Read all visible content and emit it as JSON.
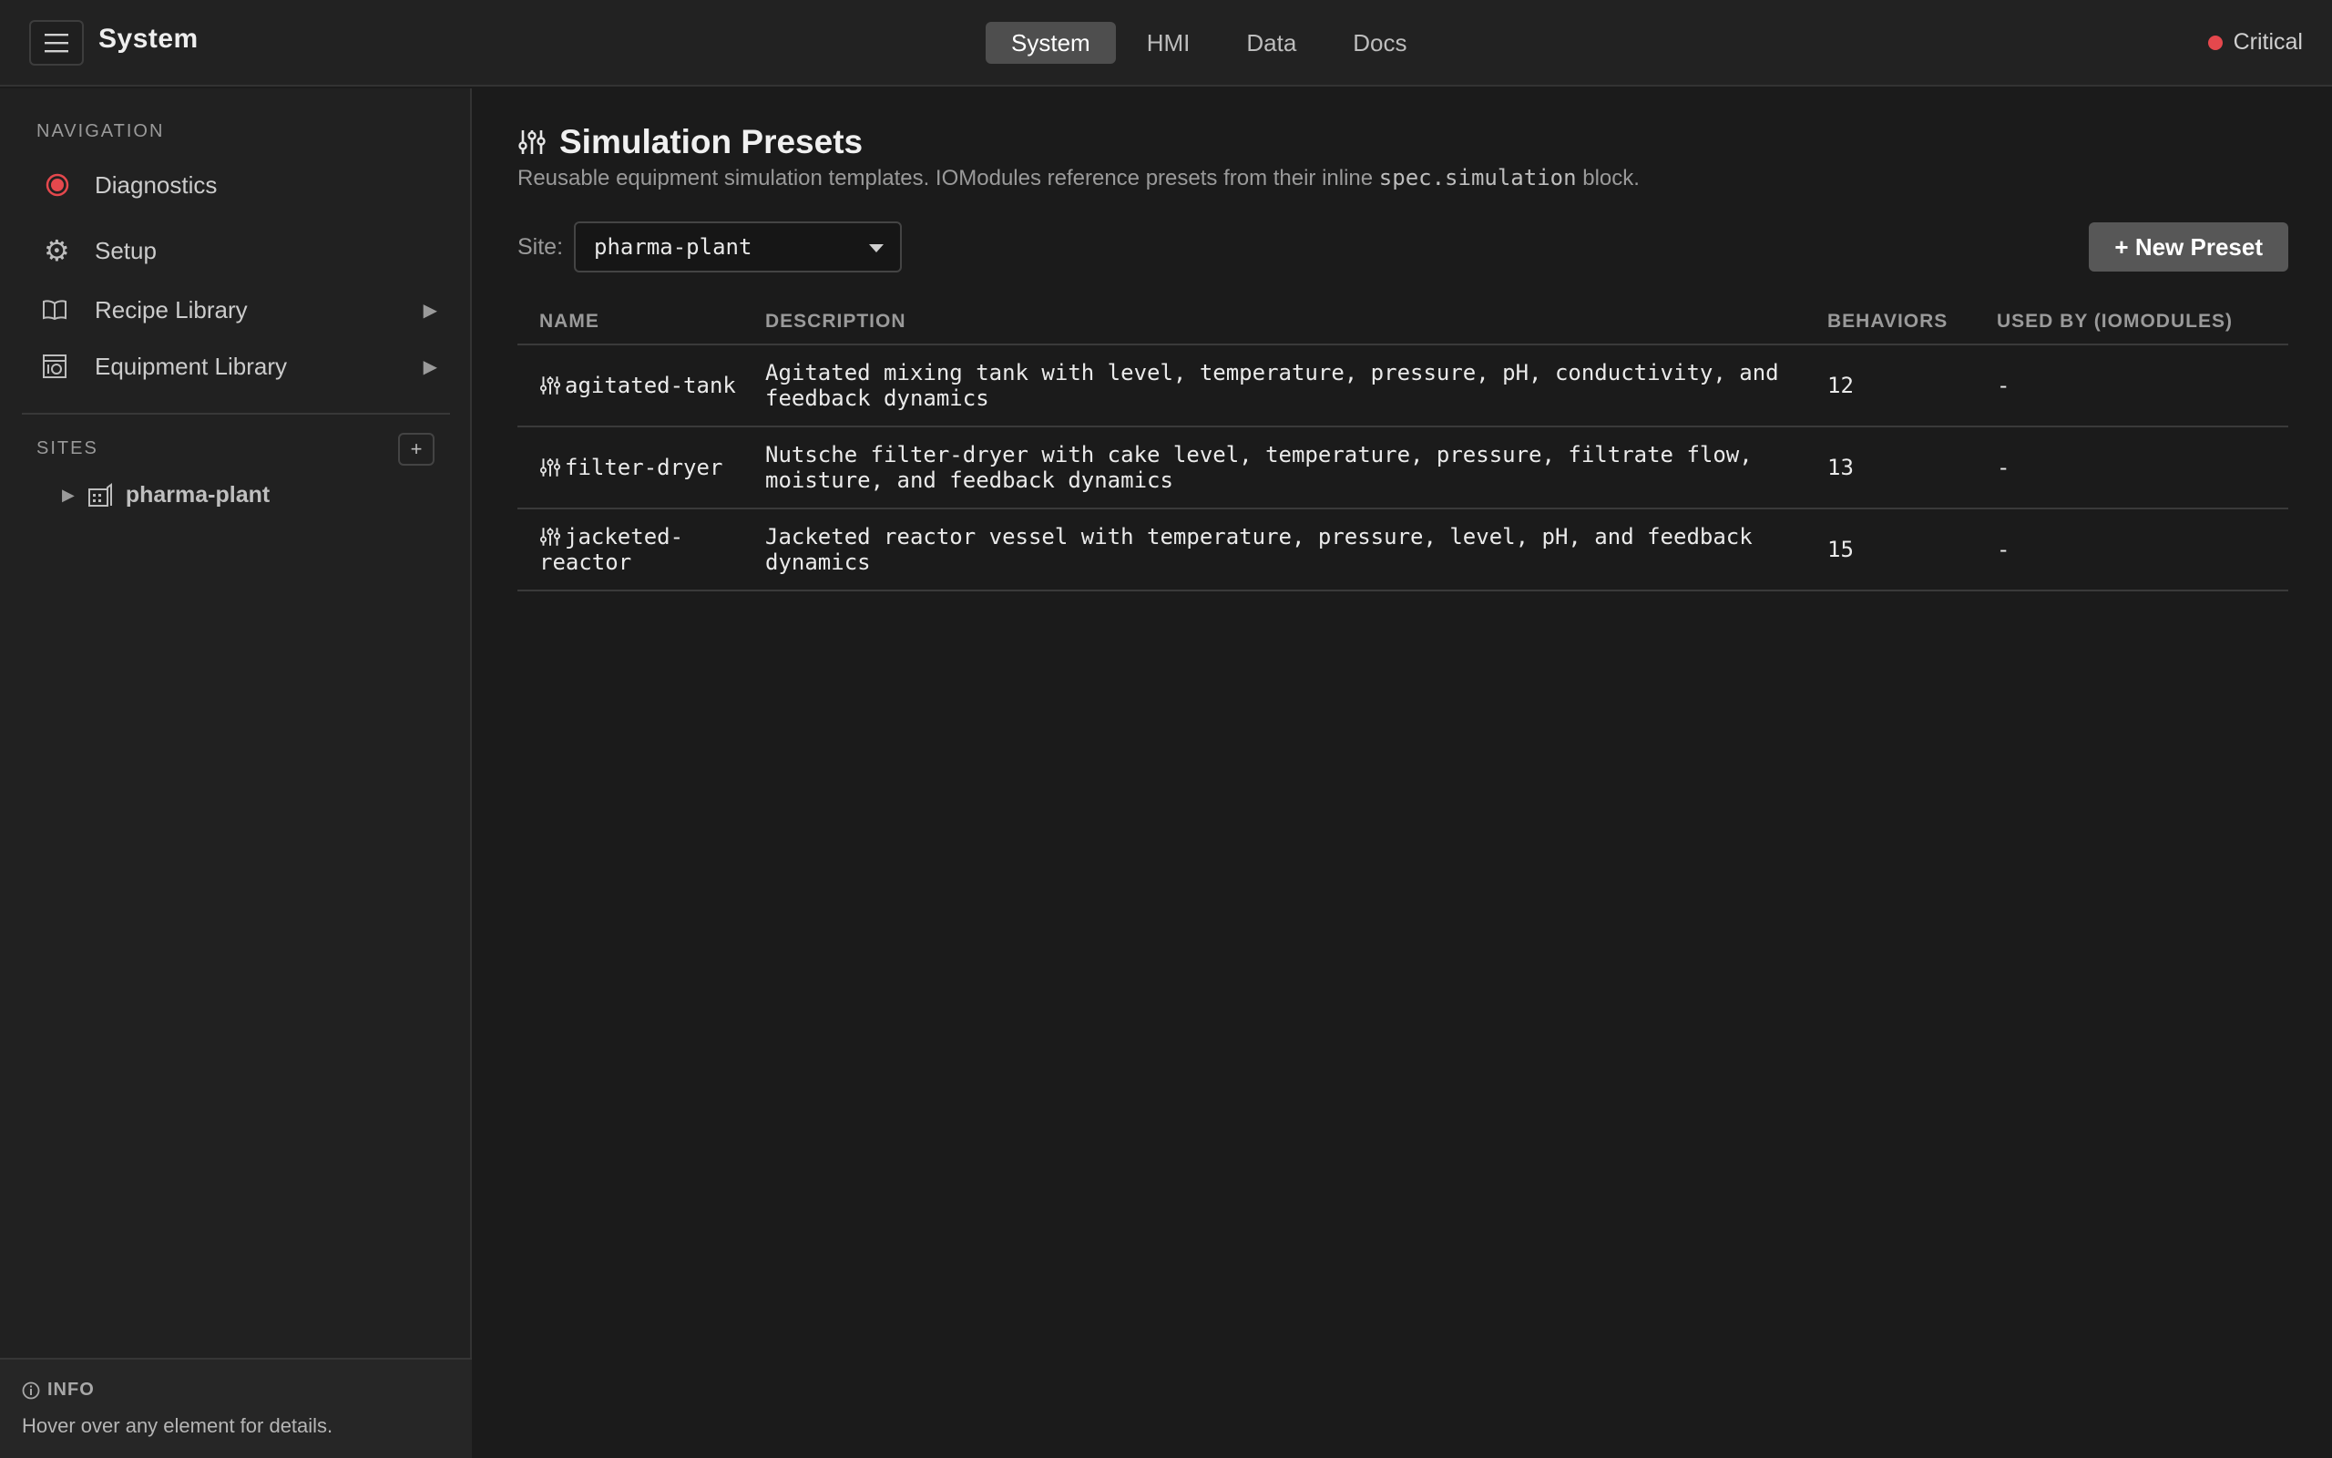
{
  "app": {
    "title": "System"
  },
  "header": {
    "tabs": [
      {
        "label": "System",
        "active": true
      },
      {
        "label": "HMI",
        "active": false
      },
      {
        "label": "Data",
        "active": false
      },
      {
        "label": "Docs",
        "active": false
      }
    ],
    "status": {
      "label": "Critical",
      "color": "#e5484d"
    }
  },
  "sidebar": {
    "nav_label": "NAVIGATION",
    "items": [
      {
        "label": "Diagnostics",
        "icon": "record-icon"
      },
      {
        "label": "Setup",
        "icon": "gear-icon"
      },
      {
        "label": "Recipe Library",
        "icon": "book-icon",
        "expand_icon": "▶"
      },
      {
        "label": "Equipment Library",
        "icon": "equipment-icon",
        "expand_icon": "▶"
      }
    ],
    "sites_label": "SITES",
    "add_site_label": "+",
    "sites": [
      {
        "label": "pharma-plant",
        "expand_icon": "▶"
      }
    ],
    "info": {
      "title": "INFO",
      "text": "Hover over any element for details."
    }
  },
  "main": {
    "title": "Simulation Presets",
    "subtitle_before": "Reusable equipment simulation templates. IOModules reference presets from their inline ",
    "subtitle_code": "spec.simulation",
    "subtitle_after": " block.",
    "site_label": "Site:",
    "site_value": "pharma-plant",
    "new_button": "+ New Preset",
    "table": {
      "columns": [
        "NAME",
        "DESCRIPTION",
        "BEHAVIORS",
        "USED BY (IOMODULES)"
      ],
      "rows": [
        {
          "name": "agitated-tank",
          "description": "Agitated mixing tank with level, temperature, pressure, pH, conductivity, and feedback dynamics",
          "behaviors": "12",
          "used_by": "-"
        },
        {
          "name": "filter-dryer",
          "description": "Nutsche filter-dryer with cake level, temperature, pressure, filtrate flow, moisture, and feedback dynamics",
          "behaviors": "13",
          "used_by": "-"
        },
        {
          "name": "jacketed-reactor",
          "description": "Jacketed reactor vessel with temperature, pressure, level, pH, and feedback dynamics",
          "behaviors": "15",
          "used_by": "-"
        }
      ]
    }
  }
}
